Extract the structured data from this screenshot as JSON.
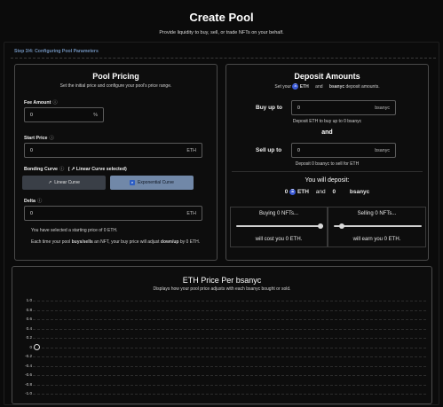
{
  "header": {
    "title": "Create Pool",
    "subtitle": "Provide liquidity to buy, sell, or trade NFTs on your behalf."
  },
  "step": {
    "label": "Step 3/4: Configuring Pool Parameters"
  },
  "pricing": {
    "title": "Pool Pricing",
    "subtitle": "Set the initial price and configure your pool's price range.",
    "fee": {
      "label": "Fee Amount",
      "value": "0",
      "suffix": "%"
    },
    "start_price": {
      "label": "Start Price",
      "value": "0",
      "suffix": "ETH"
    },
    "curve": {
      "label": "Bonding Curve",
      "selected_note": "( ↗ Linear Curve selected)",
      "linear_label": "Linear Curve",
      "exponential_label": "Exponential Curve"
    },
    "delta": {
      "label": "Delta",
      "value": "0",
      "suffix": "ETH"
    },
    "note1": "You have selected a starting price of 0 ETH.",
    "note2_a": "Each time your pool ",
    "note2_b": "buys/sells",
    "note2_c": " an NFT, your buy price will adjust ",
    "note2_d": "down/up",
    "note2_e": " by 0 ETH."
  },
  "deposit": {
    "title": "Deposit Amounts",
    "subtitle_a": "Set your",
    "subtitle_b": "ETH",
    "subtitle_c": "and",
    "subtitle_d": "bsanyc",
    "subtitle_e": "deposit amounts.",
    "buy": {
      "label": "Buy up to",
      "value": "0",
      "suffix": "bsanyc",
      "note": "Deposit ETH to buy up to 0 bsanyc"
    },
    "and_label": "and",
    "sell": {
      "label": "Sell up to",
      "value": "0",
      "suffix": "bsanyc",
      "note": "Deposit 0 bsanyc to sell for ETH"
    },
    "will_deposit": "You will deposit:",
    "eth_amount": "0",
    "eth_label": "ETH",
    "and_small": "and",
    "nft_amount": "0",
    "nft_label": "bsanyc",
    "buying_title": "Buying 0 NFTs...",
    "buying_cost": "will cost you 0 ETH.",
    "selling_title": "Selling 0 NFTs...",
    "selling_earn": "will earn you 0 ETH."
  },
  "chart": {
    "title": "ETH Price Per bsanyc",
    "subtitle": "Displays how your pool price adjusts with each bsanyc bought or sold."
  },
  "chart_data": {
    "type": "line",
    "title": "ETH Price Per bsanyc",
    "subtitle": "Displays how your pool price adjusts with each bsanyc bought or sold.",
    "y_ticks": [
      "1.0",
      "0.8",
      "0.6",
      "0.4",
      "0.2",
      "0",
      "-0.2",
      "-0.4",
      "-0.6",
      "-0.8",
      "-1.0"
    ],
    "ylim": [
      -1.0,
      1.0
    ],
    "points": [
      {
        "x": 0,
        "y": 0
      }
    ],
    "grid": true
  },
  "icons": {
    "help": "help-circle-icon",
    "eth": "eth-icon",
    "exponential": "exponential-icon",
    "linear": "linear-arrow-icon"
  },
  "colors": {
    "accent": "#7188a8",
    "step": "#6e8fb8",
    "eth": "#3c5bd6",
    "background": "#0b0b0b"
  }
}
